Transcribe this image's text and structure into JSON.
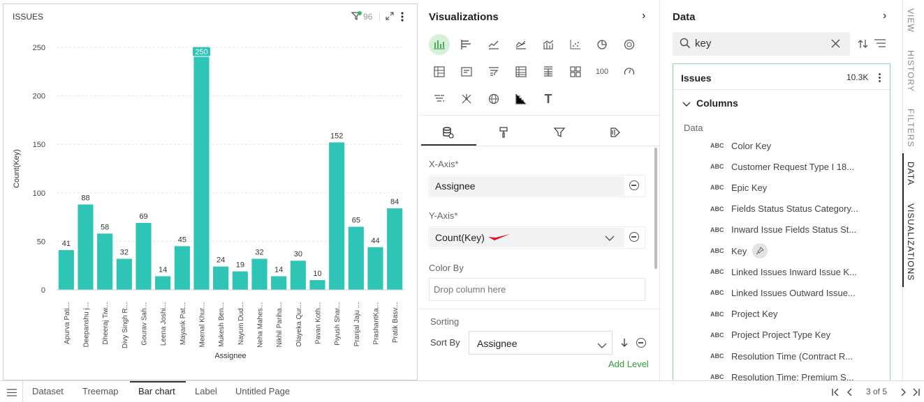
{
  "chart_panel": {
    "title": "ISSUES",
    "filter_count": "96"
  },
  "chart_data": {
    "type": "bar",
    "title": "ISSUES",
    "xlabel": "Assignee",
    "ylabel": "Count(Key)",
    "ylim": [
      0,
      250
    ],
    "yticks": [
      "0",
      "50",
      "100",
      "150",
      "200",
      "250"
    ],
    "grid": true,
    "bar_color": "#2ec4b6",
    "categories": [
      "Apurva Pati...",
      "Deepanshu j...",
      "Dheeraj Tiw...",
      "Divy Singh R...",
      "Gourav Sah...",
      "Leena Joshi...",
      "Mayank Pat...",
      "Meenal Khur...",
      "Mukesh Ben...",
      "Nayum Dud...",
      "Neha Mahes...",
      "Nikhil Pariha...",
      "Olayeka Qur...",
      "Pavan Koth...",
      "Piyush Shar...",
      "Pranjal Jaju ...",
      "PrashantKa...",
      "Pratik Basv..."
    ],
    "values": [
      41,
      88,
      58,
      32,
      69,
      14,
      45,
      250,
      24,
      19,
      32,
      14,
      30,
      10,
      152,
      65,
      44,
      84
    ],
    "labels": [
      "41",
      "88",
      "58",
      "32",
      "69",
      "14",
      "45",
      "250",
      "24",
      "19",
      "32",
      "14",
      "30",
      "10",
      "152",
      "65",
      "44",
      "84"
    ],
    "highlight_index": 7
  },
  "viz_panel": {
    "title": "Visualizations",
    "icons": [
      "bar-chart",
      "horizontal-bar",
      "line-chart",
      "area-chart",
      "combo-chart",
      "scatter-chart",
      "pie-chart",
      "donut-chart",
      "pivot-table",
      "card",
      "list-filter",
      "table",
      "grouped-table",
      "grid",
      "number-100",
      "gauge",
      "funnel",
      "network",
      "globe",
      "waterfall",
      "text"
    ],
    "kpi_label": "100",
    "text_icon_label": "T",
    "x_axis_label": "X-Axis*",
    "x_axis_value": "Assignee",
    "y_axis_label": "Y-Axis*",
    "y_axis_value": "Count(Key)",
    "color_by_label": "Color By",
    "color_by_placeholder": "Drop column here",
    "sorting_label": "Sorting",
    "sort_by_label": "Sort By",
    "sort_by_value": "Assignee",
    "add_level": "Add Level",
    "accent_color": "#2f9b3a"
  },
  "data_panel": {
    "title": "Data",
    "search_value": "key",
    "dataset_name": "Issues",
    "dataset_count": "10.3K",
    "columns_label": "Columns",
    "group_label": "Data",
    "type_label": "ABC",
    "columns": [
      "Color Key",
      "Customer Request Type I 18...",
      "Epic Key",
      "Fields Status Status Category...",
      "Inward Issue Fields Status St...",
      "Key",
      "Linked Issues Inward Issue K...",
      "Linked Issues Outward Issue...",
      "Project Key",
      "Project Project Type Key",
      "Resolution Time (Contract R...",
      "Resolution Time: Premium S..."
    ]
  },
  "side_rail": {
    "tabs": [
      "VIEW",
      "HISTORY",
      "FILTERS",
      "DATA",
      "VISUALIZATIONS"
    ]
  },
  "bottom_bar": {
    "tabs": [
      "Dataset",
      "Treemap",
      "Bar chart",
      "Label",
      "Untitled Page"
    ],
    "active_tab": "Bar chart",
    "page_indicator": "3 of 5"
  }
}
